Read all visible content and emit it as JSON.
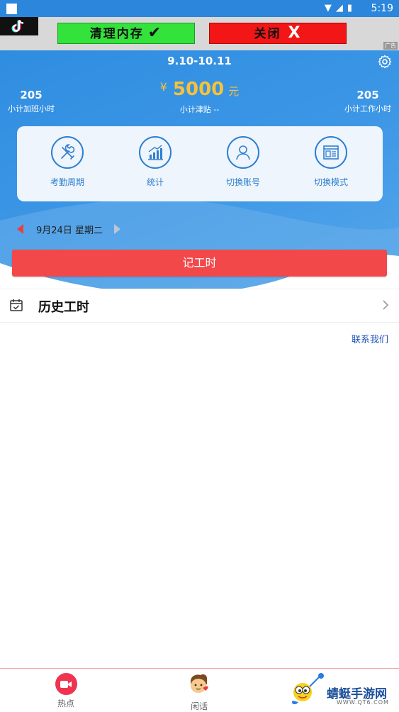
{
  "status_bar": {
    "time": "5:19"
  },
  "ad": {
    "clean_label": "清理内存",
    "close_label": "关闭",
    "close_glyph": "X",
    "corner_label": "广告"
  },
  "header": {
    "period": "9.10-10.11",
    "overtime": {
      "value": "205",
      "label": "小计加班小时"
    },
    "subsidy": {
      "currency": "¥",
      "amount": "5000",
      "unit": "元",
      "label": "小计津贴 --"
    },
    "work": {
      "value": "205",
      "label": "小计工作小时"
    }
  },
  "menu": {
    "items": [
      {
        "label": "考勤周期",
        "icon": "wrench-screwdriver-icon"
      },
      {
        "label": "统计",
        "icon": "bar-chart-icon"
      },
      {
        "label": "切换账号",
        "icon": "user-icon"
      },
      {
        "label": "切换模式",
        "icon": "window-icon"
      }
    ]
  },
  "date_nav": {
    "date": "9月24日 星期二"
  },
  "record_button": {
    "label": "记工时"
  },
  "history": {
    "title": "历史工时"
  },
  "contact": {
    "label": "联系我们"
  },
  "tabbar": {
    "tabs": [
      {
        "label": "热点",
        "icon": "video-camera-icon"
      },
      {
        "label": "闲话",
        "icon": "cartoon-face-icon"
      }
    ]
  },
  "watermark": {
    "text": "蜻蜓手游网",
    "url": "WWW.QT6.COM"
  },
  "colors": {
    "primary_blue": "#2f8de0",
    "accent_yellow": "#f6c23a",
    "record_red": "#f2484a",
    "link_blue": "#1f4fb8"
  }
}
